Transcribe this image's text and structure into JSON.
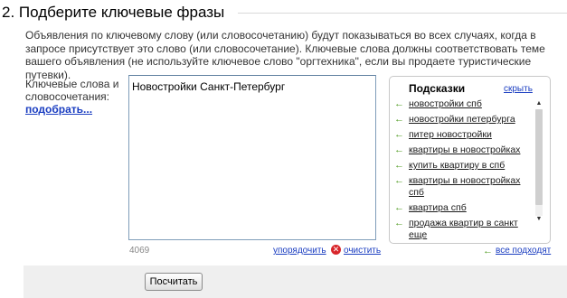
{
  "section": {
    "title": "2. Подберите ключевые фразы",
    "description": "Объявления по ключевому слову (или словосочетанию) будут показываться во всех случаях, когда в запросе присутствует это слово (или словосочетание). Ключевые слова должны соответствовать теме вашего объявления (не используйте ключевое слово \"оргтехника\", если вы продаете туристические путевки)."
  },
  "keywords": {
    "label": "Ключевые слова и словосочетания:",
    "pick_link": "подобрать...",
    "value": "Новостройки Санкт-Петербург",
    "counter": "4069",
    "sort_link": "упорядочить",
    "clear_link": "очистить"
  },
  "hints": {
    "title": "Подсказки",
    "hide_link": "скрыть",
    "items": [
      "новостройки спб",
      "новостройки петербурга",
      "питер новостройки",
      "квартиры в новостройках",
      "купить квартиру в спб",
      "квартиры в новостройках спб",
      "квартира спб",
      "продажа квартир в санкт еще"
    ],
    "all_fit_link": "все подходят"
  },
  "footer": {
    "calculate_button": "Посчитать"
  },
  "colors": {
    "link": "#1a3dc1",
    "arrow": "#4c9a1e",
    "clear_icon": "#d8262b",
    "footer_bg": "#efefef"
  }
}
